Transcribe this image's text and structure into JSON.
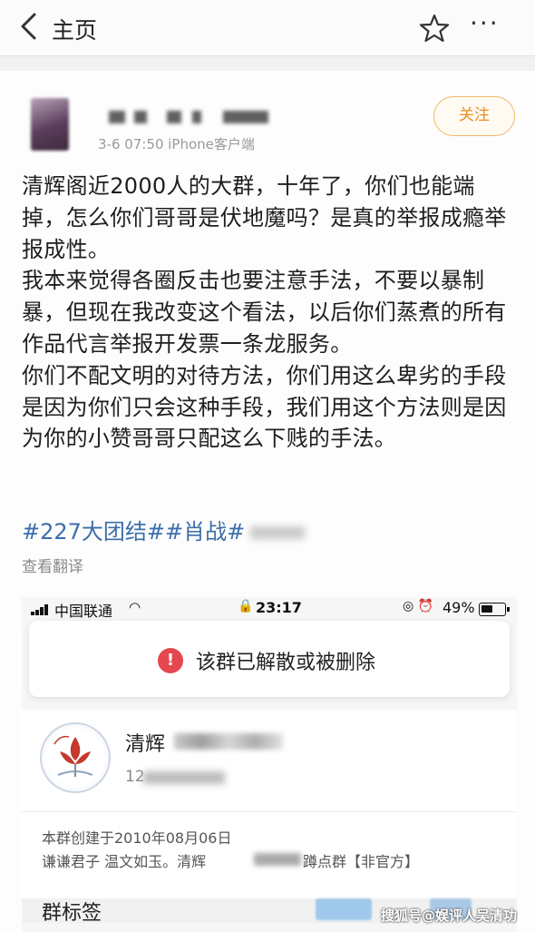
{
  "nav": {
    "title": "主页",
    "back_icon": "chevron-left-icon",
    "star_icon": "star-outline-icon",
    "more_label": "···"
  },
  "post": {
    "meta": "3-6 07:50  iPhone客户端",
    "follow_label": "关注",
    "paragraphs": [
      "清辉阁近2000人的大群，十年了，你们也能端掉，怎么你们哥哥是伏地魔吗？是真的举报成瘾举报成性。",
      "我本来觉得各圈反击也要注意手法，不要以暴制暴，但现在我改变这个看法，以后你们蒸煮的所有作品代言举报开发票一条龙服务。",
      "你们不配文明的对待方法，你们用这么卑劣的手段是因为你们只会这种手段，我们用这个方法则是因为你的小赞哥哥只配这么下贱的手法。"
    ],
    "tags": "#227大团结##肖战#",
    "translate_label": "查看翻译"
  },
  "embed": {
    "carrier": "中国联通",
    "time": "23:17",
    "battery": "49%",
    "toast_text": "该群已解散或被删除",
    "group_name_prefix": "清辉",
    "group_id_prefix": "12",
    "created": "本群创建于2010年08月06日",
    "desc_left": "谦谦君子 温文如玉。清辉",
    "desc_right": "蹲点群【非官方】"
  },
  "footer": {
    "tags_label": "群标签",
    "watermark": "搜狐号@娱评人吴清功"
  },
  "colors": {
    "follow": "#e58f23",
    "hashtag": "#3a6eaa",
    "alert": "#e5474e"
  }
}
